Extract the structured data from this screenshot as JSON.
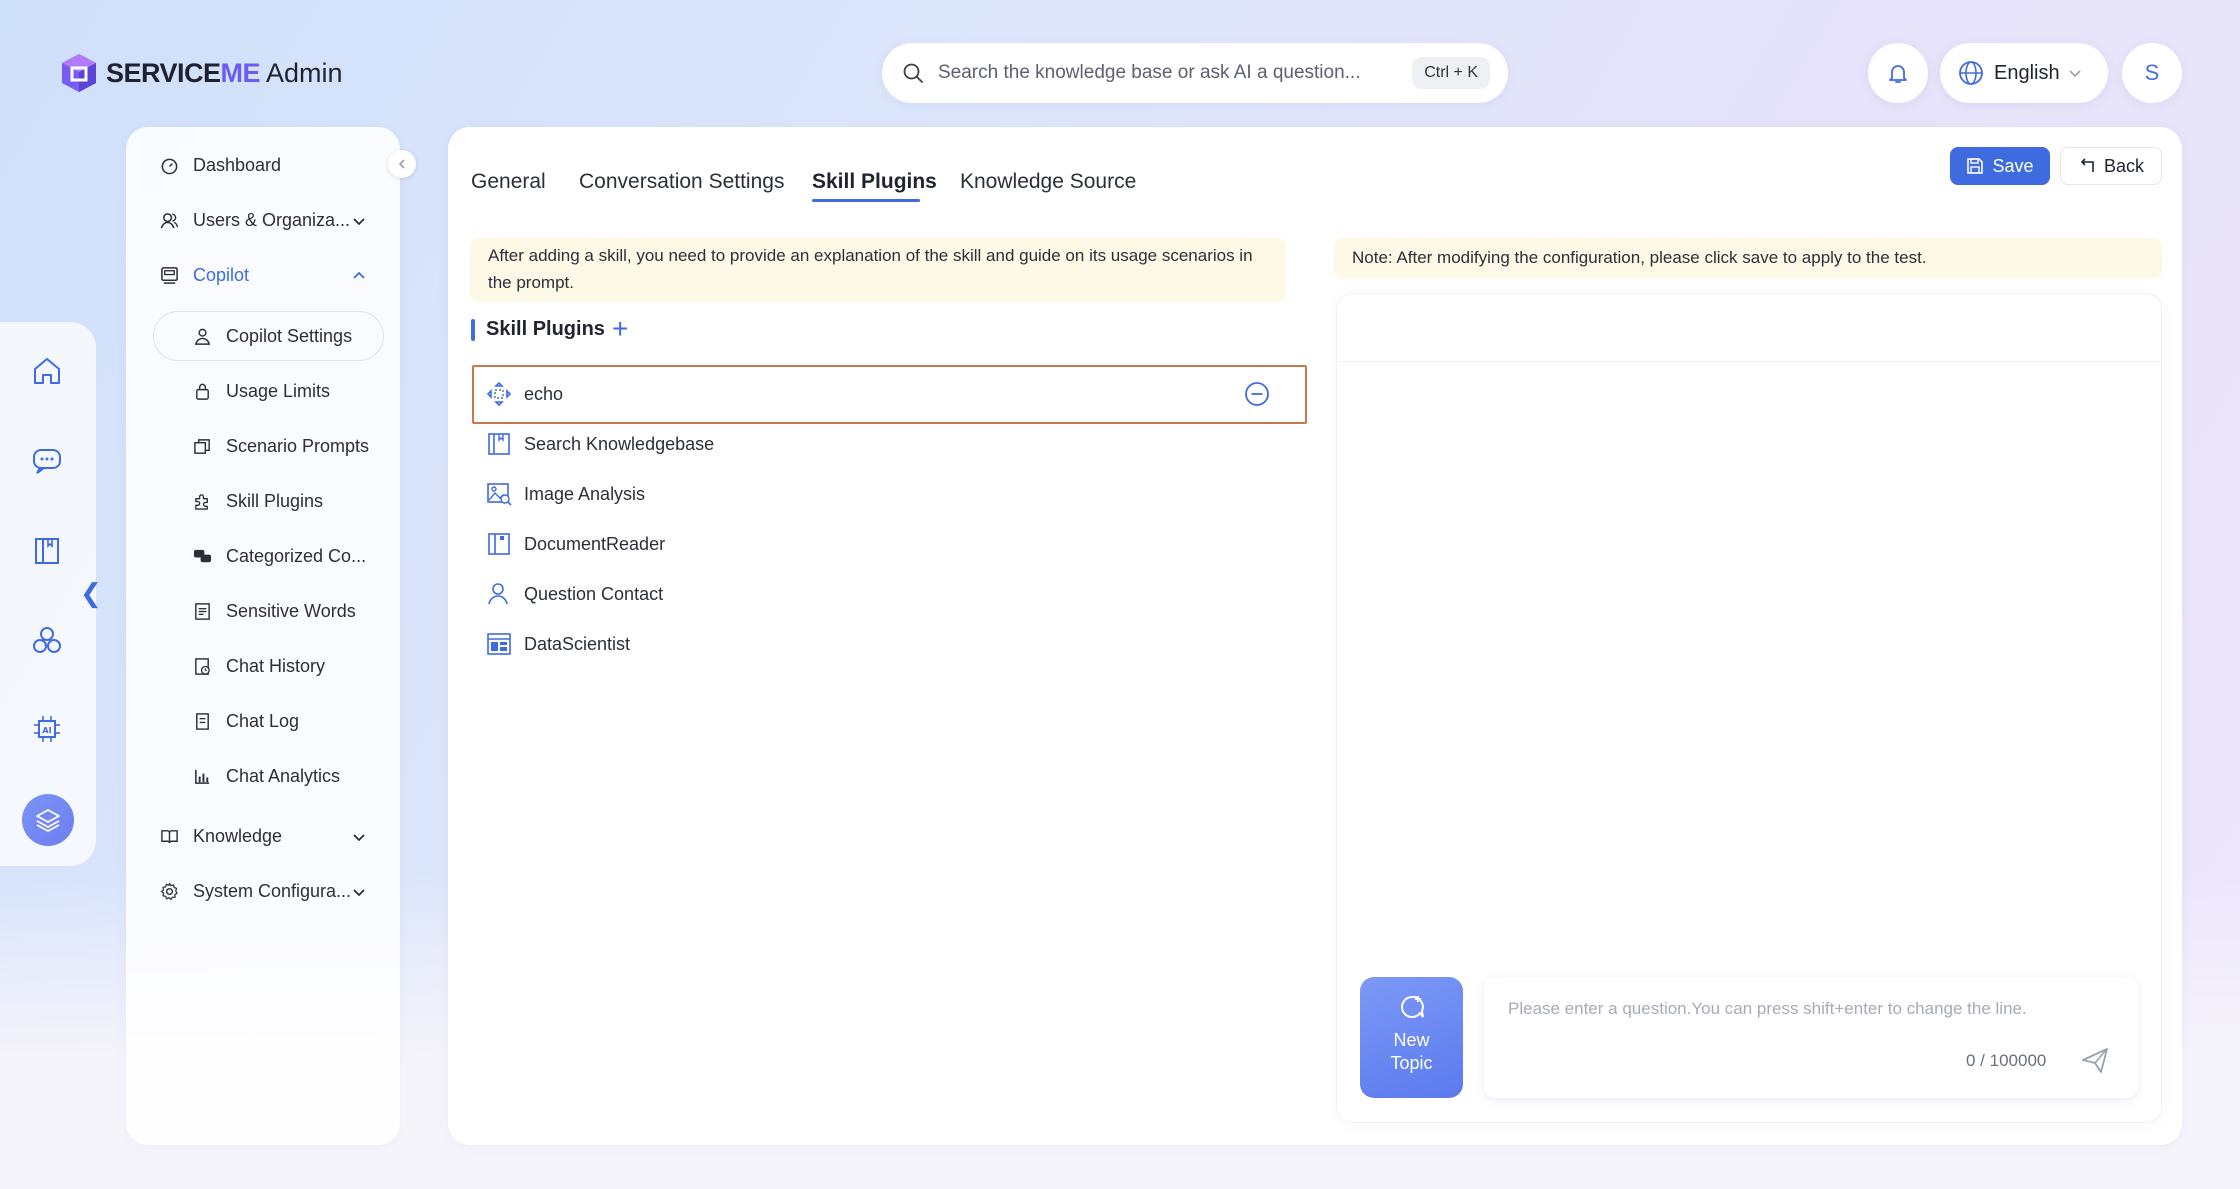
{
  "header": {
    "brand_service": "SERVICE",
    "brand_me": "ME",
    "section": "Admin",
    "search_placeholder": "Search the knowledge base or ask AI a question...",
    "search_shortcut": "Ctrl + K",
    "language": "English",
    "avatar_initial": "S"
  },
  "nav": {
    "dashboard": "Dashboard",
    "users": "Users & Organiza...",
    "copilot": "Copilot",
    "copilot_items": [
      "Copilot Settings",
      "Usage Limits",
      "Scenario Prompts",
      "Skill Plugins",
      "Categorized Co...",
      "Sensitive Words",
      "Chat History",
      "Chat Log",
      "Chat Analytics"
    ],
    "knowledge": "Knowledge",
    "system": "System Configura..."
  },
  "tabs": [
    "General",
    "Conversation Settings",
    "Skill Plugins",
    "Knowledge Source"
  ],
  "actions": {
    "save": "Save",
    "back": "Back"
  },
  "notice_left": "After adding a skill, you need to provide an explanation of the skill and guide on its usage scenarios in the prompt.",
  "notice_right": "Note: After modifying the configuration, please click save to apply to the test.",
  "section_title": "Skill Plugins",
  "add_symbol": "+",
  "plugins": [
    "echo",
    "Search Knowledgebase",
    "Image Analysis",
    "DocumentReader",
    "Question Contact",
    "DataScientist"
  ],
  "test": {
    "new_topic_line1": "New",
    "new_topic_line2": "Topic",
    "input_placeholder": "Please enter a question.You can press shift+enter to change the line.",
    "counter": "0 / 100000"
  },
  "colors": {
    "accent": "#3f6be0",
    "notice_bg": "#fdf9e6",
    "selected_border": "#c8784f"
  }
}
